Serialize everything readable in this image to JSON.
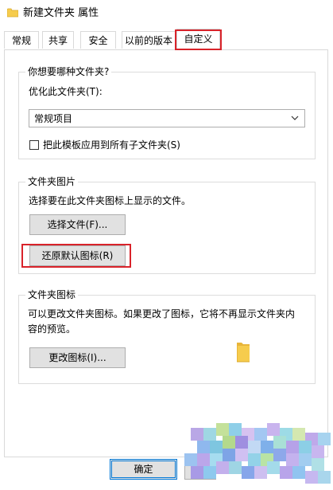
{
  "window": {
    "title": "新建文件夹 属性",
    "icon": "folder-icon"
  },
  "tabs": [
    {
      "label": "常规",
      "active": false
    },
    {
      "label": "共享",
      "active": false
    },
    {
      "label": "安全",
      "active": false
    },
    {
      "label": "以前的版本",
      "active": false
    },
    {
      "label": "自定义",
      "active": true
    }
  ],
  "optimize_group": {
    "legend": "你想要哪种文件夹?",
    "optimize_label": "优化此文件夹(T):",
    "select_value": "常规项目",
    "apply_checkbox_label": "把此模板应用到所有子文件夹(S)",
    "apply_checkbox_checked": false
  },
  "picture_group": {
    "legend": "文件夹图片",
    "description": "选择要在此文件夹图标上显示的文件。",
    "choose_file_button": "选择文件(F)...",
    "restore_default_button": "还原默认图标(R)"
  },
  "icon_group": {
    "legend": "文件夹图标",
    "description": "可以更改文件夹图标。如果更改了图标，它将不再显示文件夹内容的预览。",
    "change_icon_button": "更改图标(I)..."
  },
  "footer": {
    "ok_button": "确定"
  },
  "colors": {
    "highlight": "#d9232a",
    "folder": "#f6cc4d",
    "focus_border": "#0078d7"
  }
}
